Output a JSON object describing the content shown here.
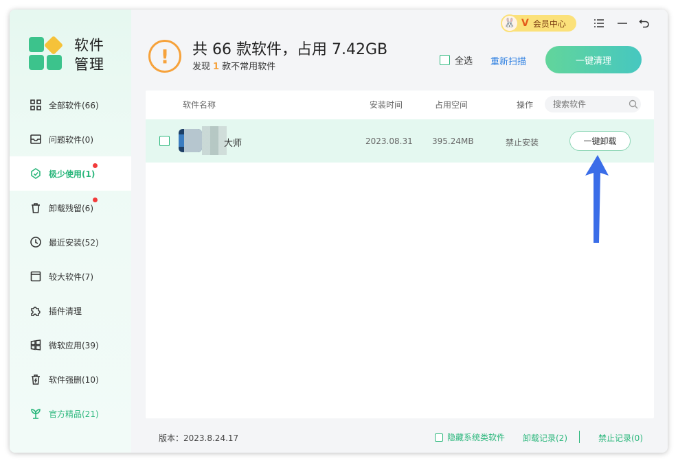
{
  "app": {
    "title": "软件管理"
  },
  "colors": {
    "accent": "#2bb77c",
    "link": "#2a7de1",
    "warning": "#f6a23b",
    "badge": "#f23b3b",
    "vip": "#fbe17a"
  },
  "sidebar": {
    "items": [
      {
        "label": "全部软件(66)",
        "icon": "grid-icon"
      },
      {
        "label": "问题软件(0)",
        "icon": "inbox-icon"
      },
      {
        "label": "极少使用(1)",
        "icon": "recycle-icon",
        "active": true,
        "badge": true
      },
      {
        "label": "卸载残留(6)",
        "icon": "trash-icon",
        "badge": true
      },
      {
        "label": "最近安装(52)",
        "icon": "clock-icon"
      },
      {
        "label": "较大软件(7)",
        "icon": "window-icon"
      },
      {
        "label": "插件清理",
        "icon": "puzzle-icon"
      },
      {
        "label": "微软应用(39)",
        "icon": "windows-icon"
      },
      {
        "label": "软件强删(10)",
        "icon": "force-delete-icon"
      },
      {
        "label": "官方精品(21)",
        "icon": "sprout-icon",
        "highlight": true
      }
    ]
  },
  "topbar": {
    "vip_label": "会员中心",
    "vip_badge": "V"
  },
  "summary": {
    "title": "共 66 款软件，占用 7.42GB",
    "sub_prefix": "发现",
    "sub_count": "1",
    "sub_suffix": "款不常用软件"
  },
  "actions": {
    "select_all": "全选",
    "rescan": "重新扫描",
    "clean_all": "一键清理"
  },
  "table": {
    "headers": {
      "name": "软件名称",
      "install_time": "安装时间",
      "size": "占用空间",
      "action": "操作"
    },
    "search_placeholder": "搜索软件",
    "rows": [
      {
        "name": "大师",
        "install_time": "2023.08.31",
        "size": "395.24MB",
        "block": "禁止安装",
        "uninstall": "一键卸载"
      }
    ]
  },
  "footer": {
    "version": "版本：2023.8.24.17",
    "hide_system": "隐藏系统类软件",
    "uninstall_records": "卸载记录(2)",
    "block_records": "禁止记录(0)"
  }
}
